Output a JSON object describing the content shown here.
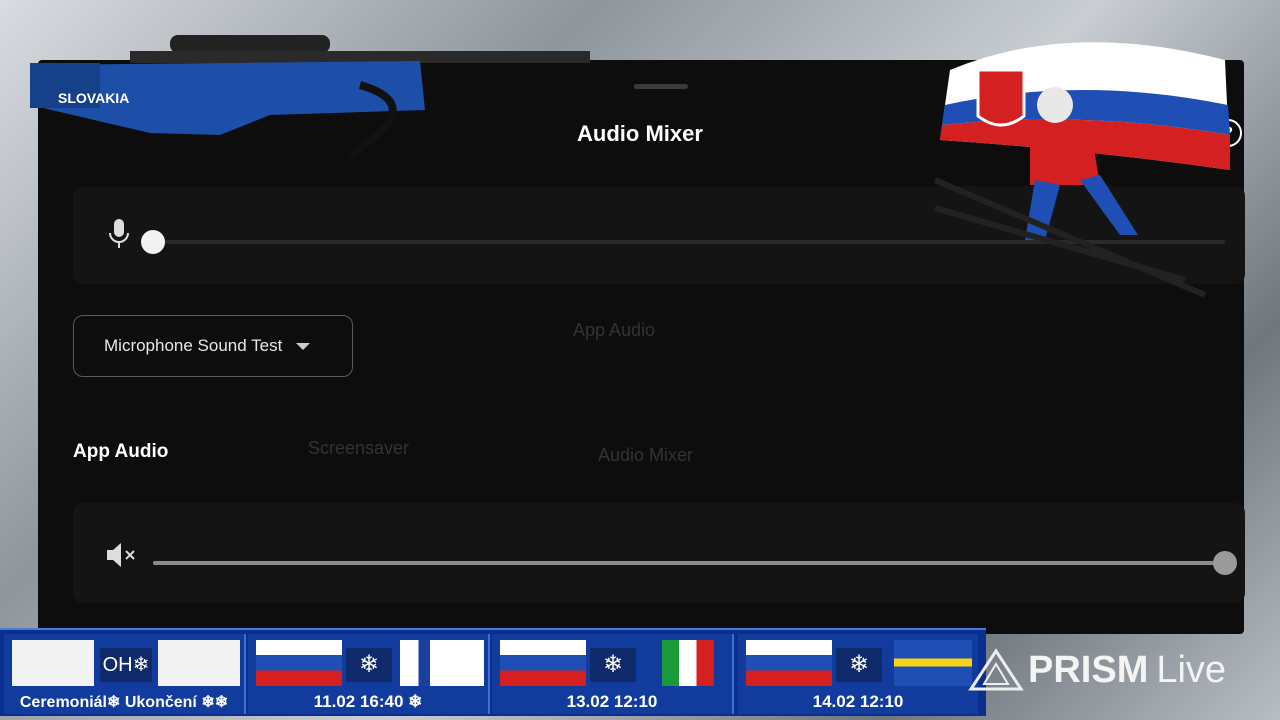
{
  "sheet": {
    "title": "Audio Mixer",
    "help_label": "?",
    "mic_slider_level": 0.0,
    "mic_test_select_value": "Microphone Sound Test",
    "app_audio_heading": "App Audio",
    "app_slider_level": 1.0
  },
  "decoration": {
    "rifle_text": "SLOVAKIA"
  },
  "ticker": {
    "tiles": [
      {
        "label": "Ceremoniál❄ Ukončení ❄❄",
        "badge": "OH❄"
      },
      {
        "label": "11.02 16:40 ❄"
      },
      {
        "label": "13.02  12:10"
      },
      {
        "label": "14.02 12:10"
      }
    ]
  },
  "watermark": {
    "brand": "PRISM",
    "suffix": "Live"
  },
  "colors": {
    "sheet_bg": "#0d0d0d",
    "card_bg": "#141414",
    "ticker_bg": "#0b2f8c"
  }
}
